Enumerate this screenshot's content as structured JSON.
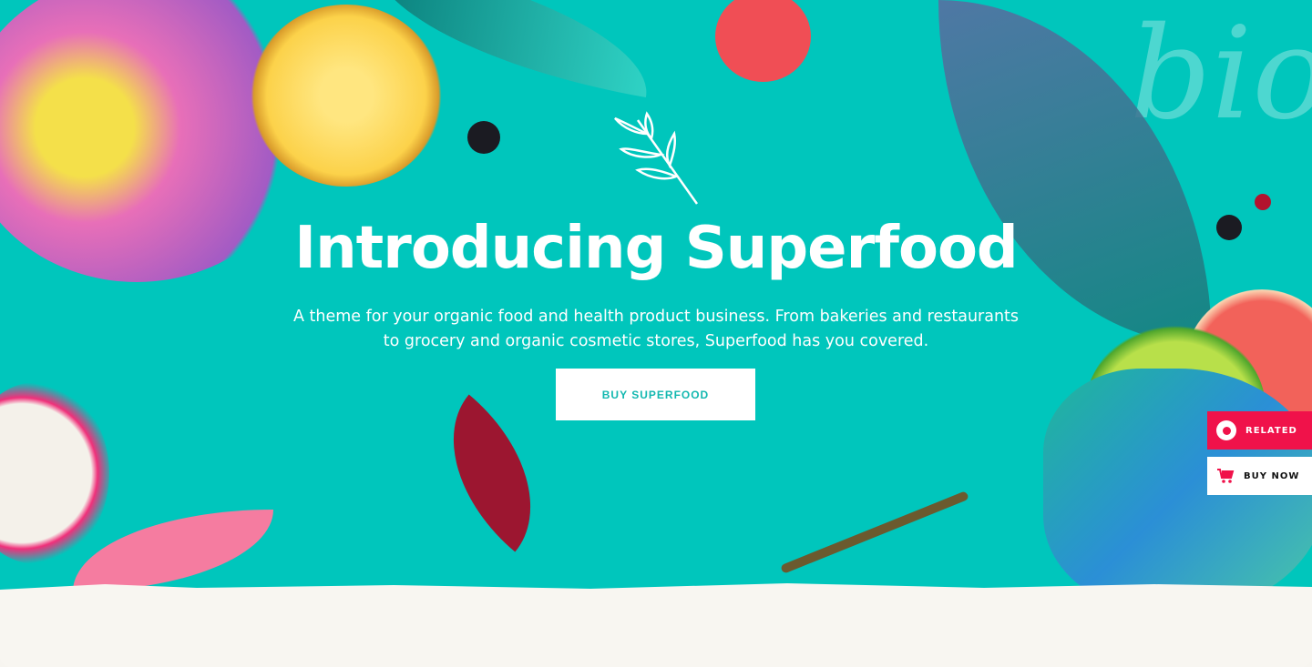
{
  "hero": {
    "watermark": "bio",
    "title": "Introducing Superfood",
    "subtitle": "A theme for your organic food and health product business. From bakeries and restaurants to grocery and organic cosmetic stores, Superfood has you covered.",
    "cta_label": "BUY SUPERFOOD"
  },
  "side_buttons": {
    "related_label": "RELATED",
    "buy_now_label": "BUY NOW"
  },
  "colors": {
    "background": "#00c6bc",
    "accent": "#f0124a"
  }
}
